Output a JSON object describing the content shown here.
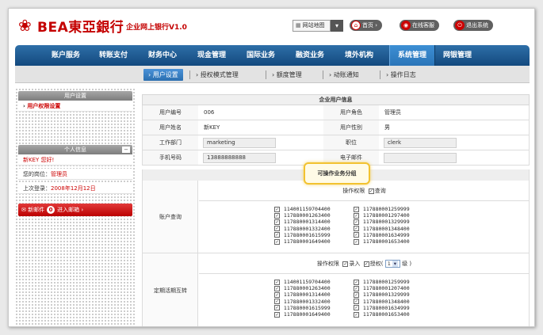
{
  "header": {
    "logo_symbol": "❀",
    "logo_text": "BEA東亞銀行",
    "system_name": "企业网上银行V1.0",
    "site_map": "网站地图",
    "buttons": [
      {
        "label": "首页",
        "icon": "home-icon"
      },
      {
        "label": "在线客服",
        "icon": "chat-icon"
      },
      {
        "label": "退出系统",
        "icon": "power-icon"
      }
    ],
    "brand_color": "#c40000"
  },
  "nav": {
    "items": [
      "账户服务",
      "转账支付",
      "财务中心",
      "现金管理",
      "国际业务",
      "融资业务",
      "境外机构",
      "系统管理",
      "网银管理"
    ],
    "active": "系统管理"
  },
  "subnav": {
    "items": [
      "用户设置",
      "授权模式管理",
      "额度管理",
      "动账通知",
      "操作日志"
    ],
    "active": "用户设置"
  },
  "sidebar": {
    "user_settings_title": "用户设置",
    "user_settings_item": "用户权限设置",
    "personal_title": "个人信息",
    "collapse": "−",
    "rows": [
      {
        "label": "新KEY 您好!",
        "value": ""
      },
      {
        "label": "您的岗位：",
        "value": "管理员"
      },
      {
        "label": "上次登录：",
        "value": "2008年12月12日"
      }
    ],
    "mail": {
      "label": "新邮件",
      "count": "0",
      "action": "进入邮箱 ›"
    }
  },
  "main": {
    "table_title": "企业用户信息",
    "fields": {
      "user_no_label": "用户编号",
      "user_no": "006",
      "role_label": "用户角色",
      "role": "管理员",
      "name_label": "用户姓名",
      "name": "新KEY",
      "gender_label": "用户性别",
      "gender": "男",
      "dept_label": "工作部门",
      "dept": "marketing",
      "position_label": "职位",
      "position": "clerk",
      "phone_label": "手机号码",
      "phone": "13888888888",
      "email_label": "电子邮件",
      "email": ""
    },
    "popup": "可操作业务分组",
    "account_query": {
      "label": "账户查询",
      "perm_label": "操作权限",
      "perm_query": "查询",
      "col1": [
        "114001159704400",
        "117880001263400",
        "117880001314400",
        "117880001332400",
        "117880001615999",
        "117880001649400"
      ],
      "col2": [
        "117880001259999",
        "117880001297400",
        "117880001329999",
        "117880001348400",
        "117880001634999",
        "117880001653400"
      ]
    },
    "fixed_transfer": {
      "label": "定期活期互转",
      "perm_label": "操作权限",
      "perm_entry": "录入",
      "perm_approve": "授权(",
      "level_value": "1",
      "level_unit": "级 )",
      "col1": [
        "114001159704400",
        "117880001263400",
        "117880001314400",
        "117880001332400",
        "117880001615999",
        "117880001649400"
      ],
      "col2": [
        "117880001259999",
        "117880001207400",
        "117880001329999",
        "117880001348400",
        "117880001634999",
        "117880001653400"
      ]
    }
  }
}
